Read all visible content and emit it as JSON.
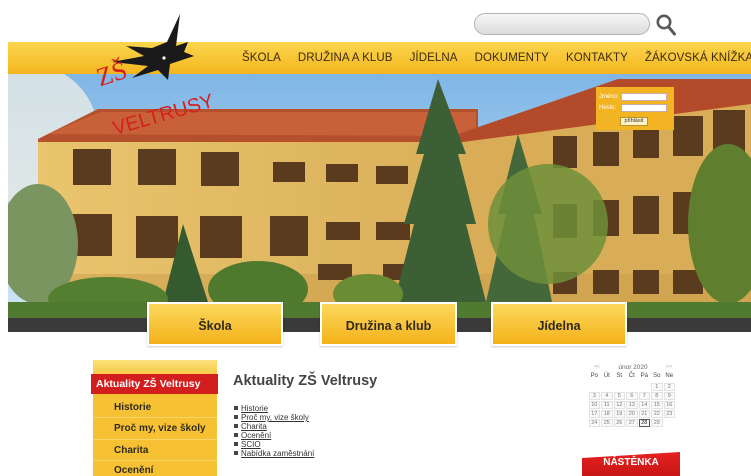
{
  "brand": {
    "logo_line1": "ZŠ",
    "logo_line2": "VELTRUSY"
  },
  "search": {
    "placeholder": ""
  },
  "nav": {
    "items": [
      "ŠKOLA",
      "DRUŽINA A KLUB",
      "JÍDELNA",
      "DOKUMENTY",
      "KONTAKTY",
      "ŽÁKOVSKÁ KNÍŽKA"
    ]
  },
  "login": {
    "username_label": "Jméno:",
    "password_label": "Heslo:",
    "submit_label": "přihlásit"
  },
  "tabs": [
    "Škola",
    "Družina a klub",
    "Jídelna"
  ],
  "sidebar": {
    "heading": "Aktuality ZŠ Veltrusy",
    "items": [
      "Historie",
      "Proč my, vize školy",
      "Charita",
      "Ocenění"
    ]
  },
  "main": {
    "title": "Aktuality ZŠ Veltrusy",
    "links": [
      "Historie",
      "Proč my, vize školy",
      "Charita",
      "Ocenění",
      "SCIO",
      "Nabídka zaměstnání"
    ]
  },
  "calendar": {
    "prev": "<<",
    "next": ">>",
    "month_label": "únor 2020",
    "weekdays": [
      "Po",
      "Út",
      "St",
      "Čt",
      "Pá",
      "So",
      "Ne"
    ],
    "weeks": [
      [
        "",
        "",
        "",
        "",
        "",
        "1",
        "2"
      ],
      [
        "3",
        "4",
        "5",
        "6",
        "7",
        "8",
        "9"
      ],
      [
        "10",
        "11",
        "12",
        "13",
        "14",
        "15",
        "16"
      ],
      [
        "17",
        "18",
        "19",
        "20",
        "21",
        "22",
        "23"
      ],
      [
        "24",
        "25",
        "26",
        "27",
        "28",
        "29",
        ""
      ]
    ],
    "today": "28"
  },
  "board": {
    "label": "NÁSTĚNKA"
  },
  "colors": {
    "accent": "#f4b41f",
    "red": "#d31e1e",
    "roof": "#c2552f",
    "wall": "#e8c573"
  }
}
